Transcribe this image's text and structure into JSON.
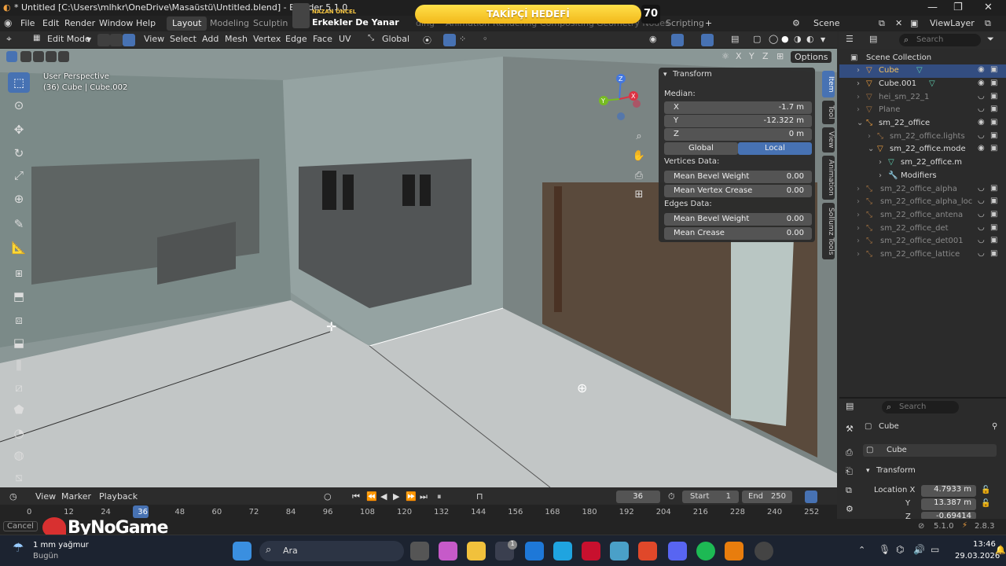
{
  "titlebar": {
    "title": "* Untitled [C:\\Users\\mlhkr\\OneDrive\\Masaüstü\\Untitled.blend] - Blender 5.1.0",
    "minimize": "—",
    "maximize": "❐",
    "close": "✕"
  },
  "menubar": {
    "items": [
      "File",
      "Edit",
      "Render",
      "Window",
      "Help"
    ],
    "workspaces": [
      "Layout",
      "Modeling",
      "Sculptin",
      "ding",
      "Animation",
      "Rendering",
      "Compositing",
      "Geometry Nodes",
      "Scripting"
    ],
    "active_workspace": "Layout",
    "add_tab": "+",
    "scene_label": "Scene",
    "viewlayer_label": "ViewLayer"
  },
  "stream_overlay": {
    "streamer_tag": "NAZAN ÖNCEL",
    "song": "Erkekler De Yanar",
    "follower_goal_label": "TAKİPÇİ HEDEFİ",
    "follower_count": "70"
  },
  "viewport_header": {
    "mode": "Edit Mode",
    "menus": [
      "View",
      "Select",
      "Add",
      "Mesh",
      "Vertex",
      "Edge",
      "Face",
      "UV"
    ],
    "orientation": "Global",
    "axes": [
      "X",
      "Y",
      "Z"
    ],
    "options": "Options"
  },
  "viewport": {
    "perspective": "User Perspective",
    "object_info": "(36) Cube | Cube.002",
    "gizmo_labels": [
      "Z",
      "Y",
      "X"
    ]
  },
  "n_panel": {
    "section": "Transform",
    "median_label": "Median:",
    "median": [
      {
        "axis": "X",
        "value": "-1.7 m"
      },
      {
        "axis": "Y",
        "value": "-12.322 m"
      },
      {
        "axis": "Z",
        "value": "0 m"
      }
    ],
    "global_btn": "Global",
    "local_btn": "Local",
    "vertices_label": "Vertices Data:",
    "vertices": [
      {
        "label": "Mean Bevel Weight",
        "value": "0.00"
      },
      {
        "label": "Mean Vertex Crease",
        "value": "0.00"
      }
    ],
    "edges_label": "Edges Data:",
    "edges": [
      {
        "label": "Mean Bevel Weight",
        "value": "0.00"
      },
      {
        "label": "Mean Crease",
        "value": "0.00"
      }
    ],
    "tabs": [
      "Item",
      "Tool",
      "View",
      "Animation",
      "Sollumz Tools"
    ]
  },
  "outliner": {
    "search_placeholder": "Search",
    "collection": "Scene Collection",
    "rows": [
      {
        "name": "Cube",
        "selected": true,
        "dim": false
      },
      {
        "name": "Cube.001",
        "selected": false,
        "dim": false
      },
      {
        "name": "hei_sm_22_1",
        "selected": false,
        "dim": true
      },
      {
        "name": "Plane",
        "selected": false,
        "dim": true
      },
      {
        "name": "sm_22_office",
        "selected": false,
        "dim": false
      },
      {
        "name": "sm_22_office.lights",
        "selected": false,
        "dim": true
      },
      {
        "name": "sm_22_office.mode",
        "selected": false,
        "dim": false
      },
      {
        "name": "sm_22_office.m",
        "selected": false,
        "dim": false
      },
      {
        "name": "Modifiers",
        "selected": false,
        "dim": false
      },
      {
        "name": "sm_22_office_alpha",
        "selected": false,
        "dim": true
      },
      {
        "name": "sm_22_office_alpha_loc",
        "selected": false,
        "dim": true
      },
      {
        "name": "sm_22_office_antena",
        "selected": false,
        "dim": true
      },
      {
        "name": "sm_22_office_det",
        "selected": false,
        "dim": true
      },
      {
        "name": "sm_22_office_det001",
        "selected": false,
        "dim": true
      },
      {
        "name": "sm_22_office_lattice",
        "selected": false,
        "dim": true
      }
    ]
  },
  "properties": {
    "search_placeholder": "Search",
    "object_name": "Cube",
    "data_name": "Cube",
    "section": "Transform",
    "location_label": "Location X",
    "location": [
      {
        "axis": "X",
        "value": "4.7933 m"
      },
      {
        "axis": "Y",
        "value": "13.387 m"
      },
      {
        "axis": "Z",
        "value": "-0.69414"
      }
    ]
  },
  "timeline": {
    "menus": [
      "View",
      "Marker",
      "Playback"
    ],
    "current_frame": "36",
    "start_label": "Start",
    "start": "1",
    "end_label": "End",
    "end": "250",
    "ticks": [
      "0",
      "12",
      "24",
      "36",
      "48",
      "60",
      "72",
      "84",
      "96",
      "108",
      "120",
      "132",
      "144",
      "156",
      "168",
      "180",
      "192",
      "204",
      "216",
      "228",
      "240",
      "252"
    ]
  },
  "statusbar": {
    "cancel": "Cancel",
    "watermark": "ByNoGame",
    "version": "5.1.0",
    "fps": "2.8.3"
  },
  "taskbar": {
    "weather_temp": "1 mm yağmur",
    "weather_day": "Bugün",
    "search": "Ara",
    "time": "13:46",
    "date": "29.03.2026",
    "badge": "1"
  },
  "colors": {
    "accent": "#4772b3",
    "selection": "#334d80",
    "gold": "#f5c542",
    "bg": "#2b2b2b"
  }
}
